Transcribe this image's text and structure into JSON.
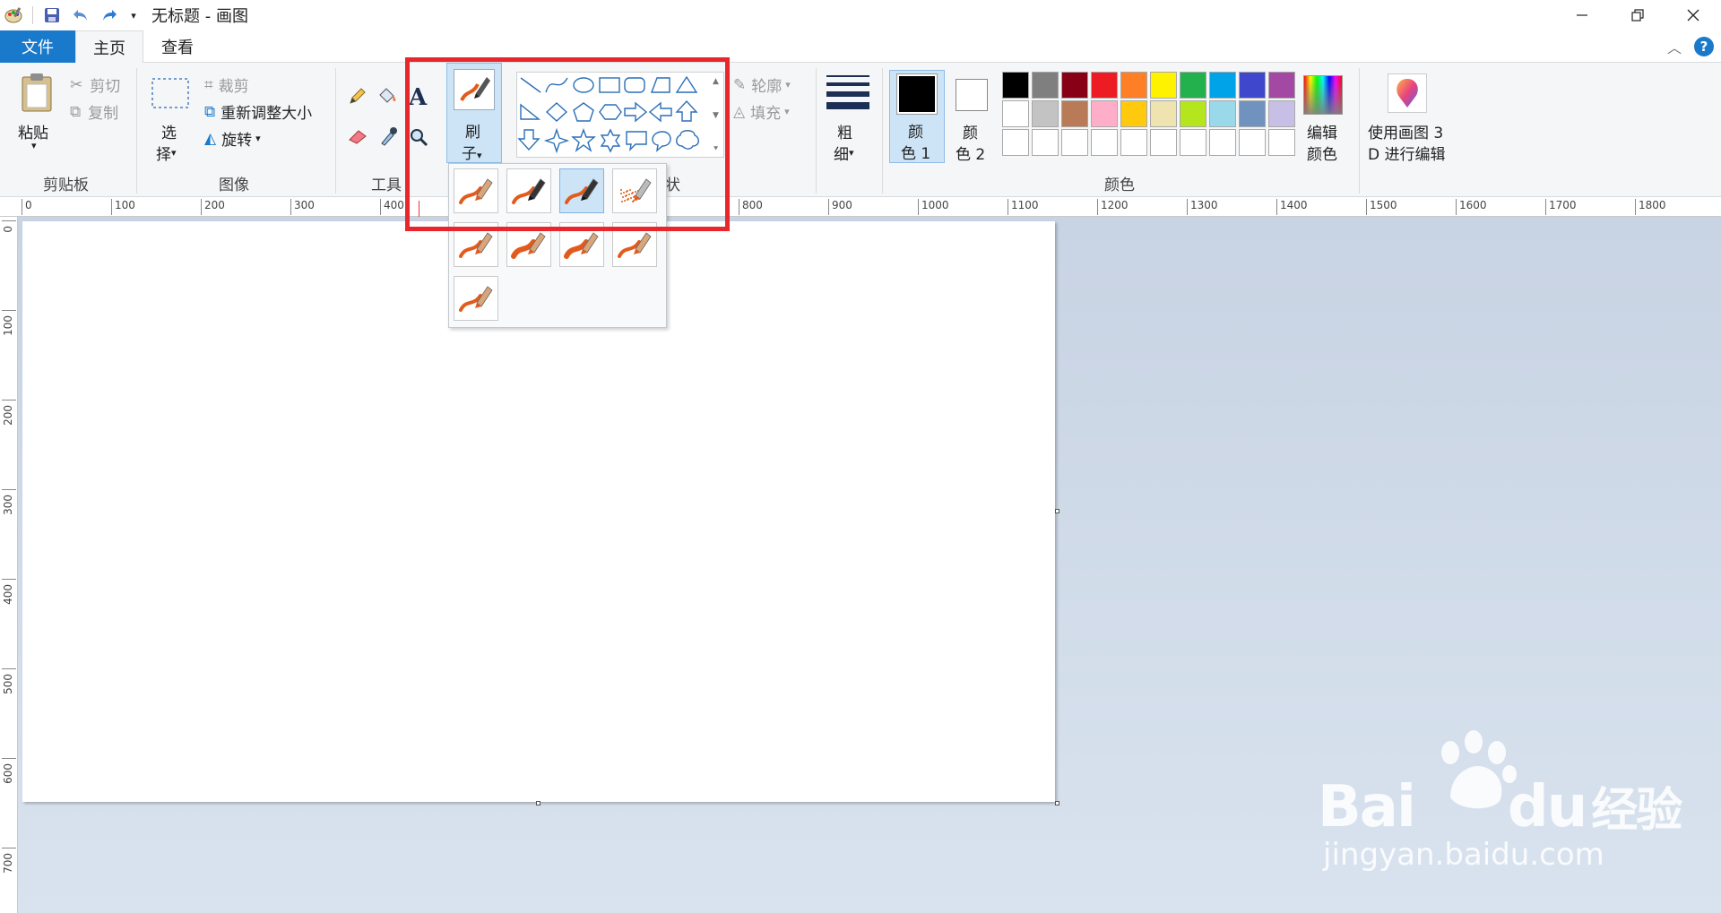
{
  "window": {
    "title": "无标题 - 画图"
  },
  "tabs": {
    "file": "文件",
    "home": "主页",
    "view": "查看"
  },
  "ribbon": {
    "clipboard": {
      "paste": "粘贴",
      "cut": "剪切",
      "copy": "复制",
      "label": "剪贴板"
    },
    "image": {
      "select_1": "选",
      "select_2": "择",
      "crop": "裁剪",
      "resize": "重新调整大小",
      "rotate": "旋转",
      "label": "图像"
    },
    "tools": {
      "label": "工具"
    },
    "brushes": {
      "label_1": "刷",
      "label_2": "子"
    },
    "shapes": {
      "outline": "轮廓",
      "fill": "填充",
      "label_partial": "状"
    },
    "size": {
      "label_1": "粗",
      "label_2": "细"
    },
    "color1": {
      "label_1": "颜",
      "label_2": "色 1"
    },
    "color2": {
      "label_1": "颜",
      "label_2": "色 2"
    },
    "edit_colors": {
      "label_1": "编辑",
      "label_2": "颜色"
    },
    "paint3d": {
      "label_1": "使用画图 3",
      "label_2": "D 进行编辑"
    },
    "colors_label": "颜色",
    "palette_row1": [
      "#000000",
      "#7f7f7f",
      "#880015",
      "#ed1c24",
      "#ff7f27",
      "#fff200",
      "#22b14c",
      "#00a2e8",
      "#3f48cc",
      "#a349a4"
    ],
    "palette_row2": [
      "#ffffff",
      "#c3c3c3",
      "#b97a57",
      "#ffaec9",
      "#ffc90e",
      "#efe4b0",
      "#b5e61d",
      "#99d9ea",
      "#7092be",
      "#c8bfe7"
    ],
    "palette_row3": [
      "#ffffff",
      "#ffffff",
      "#ffffff",
      "#ffffff",
      "#ffffff",
      "#ffffff",
      "#ffffff",
      "#ffffff",
      "#ffffff",
      "#ffffff"
    ]
  },
  "ruler": {
    "h_ticks": [
      "0",
      "100",
      "200",
      "300",
      "400",
      "800",
      "900",
      "1000",
      "1100",
      "1200",
      "1300",
      "1400",
      "1500",
      "1600",
      "1700",
      "1800"
    ],
    "v_ticks": [
      "0",
      "100",
      "200",
      "300",
      "400",
      "500",
      "600",
      "700"
    ]
  },
  "brush_options": [
    "brush",
    "calligraphy-brush-1",
    "calligraphy-brush-2",
    "airbrush",
    "oil-brush",
    "crayon",
    "marker",
    "natural-pencil",
    "watercolor-brush"
  ],
  "watermark": {
    "brand": "Bai",
    "brand2": "du",
    "suffix": "经验",
    "url": "jingyan.baidu.com"
  },
  "colors": {
    "accent": "#1979ca",
    "highlight": "#e8262b"
  }
}
